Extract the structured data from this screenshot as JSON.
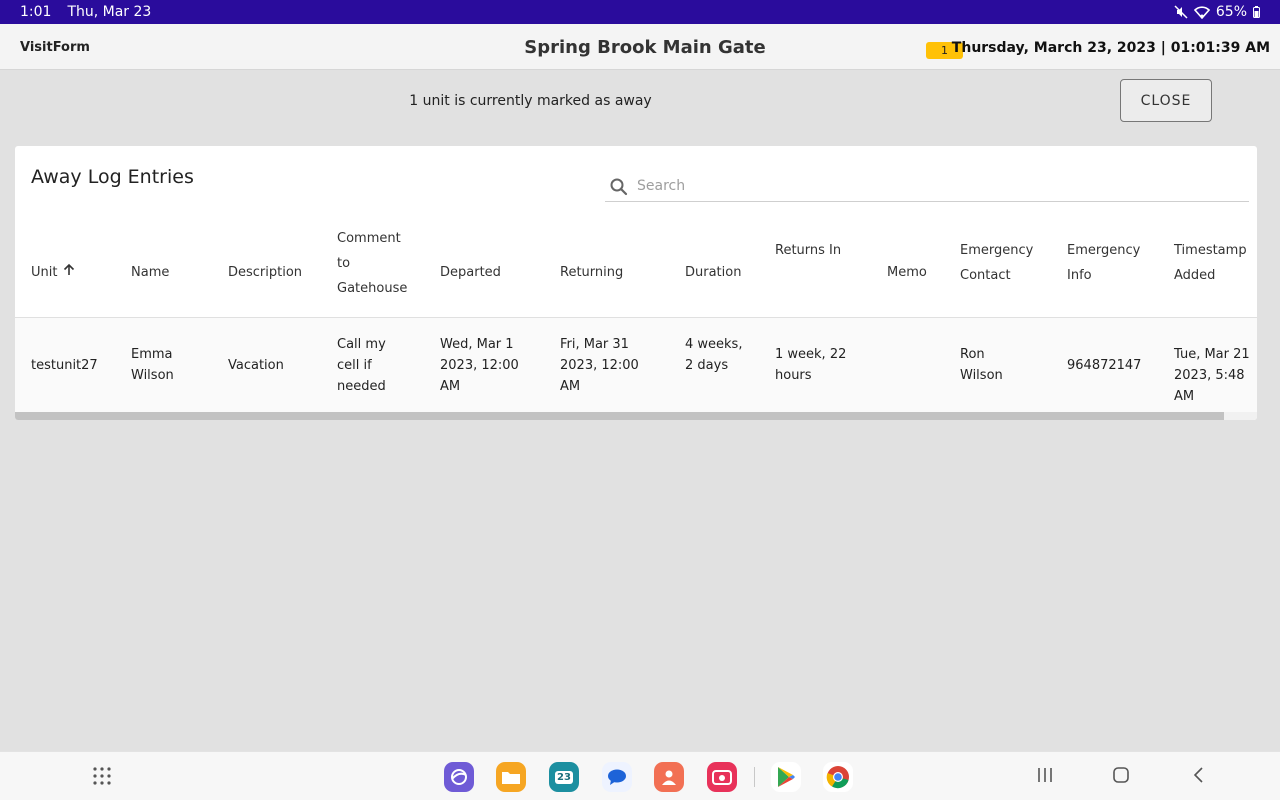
{
  "status_bar": {
    "time": "1:01",
    "date": "Thu, Mar 23",
    "battery": "65%"
  },
  "header": {
    "brand": "VisitForm",
    "title": "Spring Brook Main Gate",
    "badge_count": "1",
    "datetime": "Thursday, March 23, 2023 | 01:01:39 AM"
  },
  "away": {
    "message": "1 unit is currently marked as away",
    "close_label": "CLOSE"
  },
  "card": {
    "title": "Away Log Entries",
    "search_placeholder": "Search"
  },
  "table": {
    "columns": [
      {
        "label": "Unit",
        "sort": "asc"
      },
      {
        "label": "Name"
      },
      {
        "label": "Description"
      },
      {
        "label": "Comment to Gatehouse"
      },
      {
        "label": "Departed"
      },
      {
        "label": "Returning"
      },
      {
        "label": "Duration"
      },
      {
        "label": "Returns In"
      },
      {
        "label": "Memo"
      },
      {
        "label": "Emergency Contact"
      },
      {
        "label": "Emergency Info"
      },
      {
        "label": "Timestamp Added"
      }
    ],
    "rows": [
      {
        "unit": "testunit27",
        "name": "Emma Wilson",
        "description": "Vacation",
        "comment": "Call my cell if needed",
        "departed": "Wed, Mar 1 2023, 12:00 AM",
        "returning": "Fri, Mar 31 2023, 12:00 AM",
        "duration": "4 weeks, 2 days",
        "returns_in": "1 week, 22 hours",
        "memo": "",
        "emergency_contact": "Ron Wilson",
        "emergency_info": "964872147",
        "timestamp_added": "Tue, Mar 21 2023, 5:48 AM"
      }
    ]
  },
  "dock": {
    "apps": [
      {
        "icon": "internet-icon",
        "color": "#6f5bd6"
      },
      {
        "icon": "files-icon",
        "color": "#f6a623"
      },
      {
        "icon": "calendar-icon",
        "color": "#1c8fa0",
        "text": "23"
      },
      {
        "icon": "messages-icon",
        "color": "#1d63d8"
      },
      {
        "icon": "contacts-icon",
        "color": "#f27054"
      },
      {
        "icon": "camera-icon",
        "color": "#e8325a"
      },
      {
        "icon": "play-store-icon",
        "color": "#34a853"
      },
      {
        "icon": "chrome-icon",
        "color": "#4285f4"
      }
    ]
  }
}
